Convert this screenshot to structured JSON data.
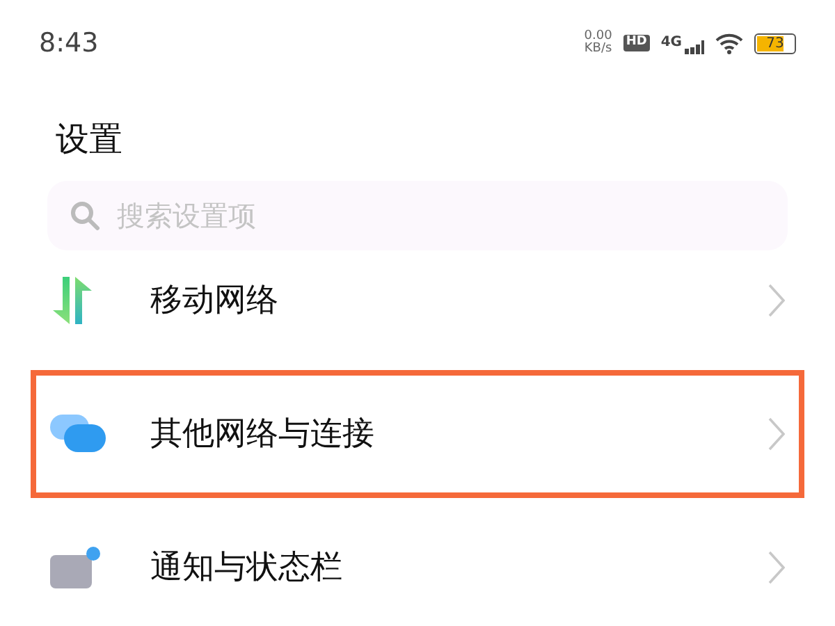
{
  "status_bar": {
    "time": "8:43",
    "net_speed": "0.00",
    "net_unit": "KB/s",
    "hd_badge": "HD",
    "network_type": "4G",
    "battery": {
      "text": "73",
      "level": 0.73
    }
  },
  "title": "设置",
  "search": {
    "placeholder": "搜索设置项"
  },
  "items": [
    {
      "label": "移动网络",
      "kind": "mobile",
      "highlighted": false
    },
    {
      "label": "其他网络与连接",
      "kind": "connections",
      "highlighted": true
    },
    {
      "label": "通知与状态栏",
      "kind": "notifications",
      "highlighted": false
    }
  ]
}
